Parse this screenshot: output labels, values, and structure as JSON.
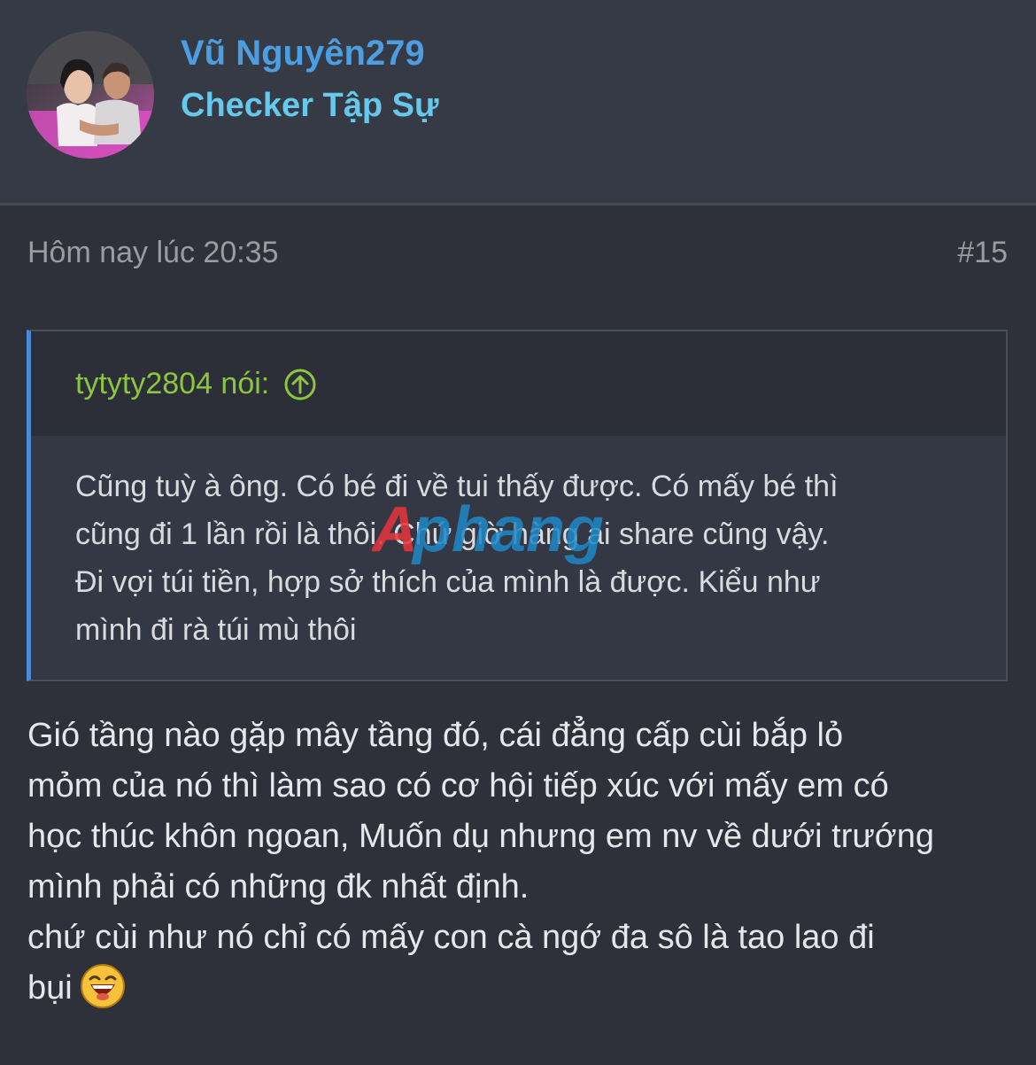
{
  "user": {
    "name": "Vũ Nguyên279",
    "title": "Checker Tập Sự"
  },
  "post": {
    "time": "Hôm nay lúc 20:35",
    "number": "#15"
  },
  "quote": {
    "author": "tytyty2804 nói:",
    "icon": "arrow-up-circle-icon",
    "lines": [
      "Cũng tuỳ à ông. Có bé đi về tui thấy được. Có mấy bé thì",
      "cũng đi 1 lần rồi là thôi. Chứ giờ hàng ai share cũng vậy.",
      "Đi vợi túi tiền, hợp sở thích của mình là được. Kiểu như",
      "mình đi rà túi mù thôi"
    ]
  },
  "watermark": "Aphang",
  "message": {
    "lines": [
      "Gió tầng nào gặp mây tầng đó, cái đẳng cấp cùi bắp lỏ",
      "mỏm của nó thì làm sao có cơ hội tiếp xúc với mấy em có",
      "học thúc khôn ngoan, Muốn dụ nhưng em nv về dưới trướng",
      "mình phải có những đk nhất định.",
      "chứ cùi như nó chỉ có mấy con cà ngớ đa sô là tao lao đi",
      "bụi"
    ],
    "emoji": "laughing-emoji"
  },
  "colors": {
    "background": "#2e313a",
    "header": "#363a45",
    "username": "#4c9ee2",
    "user_title": "#66c8ea",
    "quote_author": "#8cc63f",
    "quote_border": "#4a8ad6"
  }
}
